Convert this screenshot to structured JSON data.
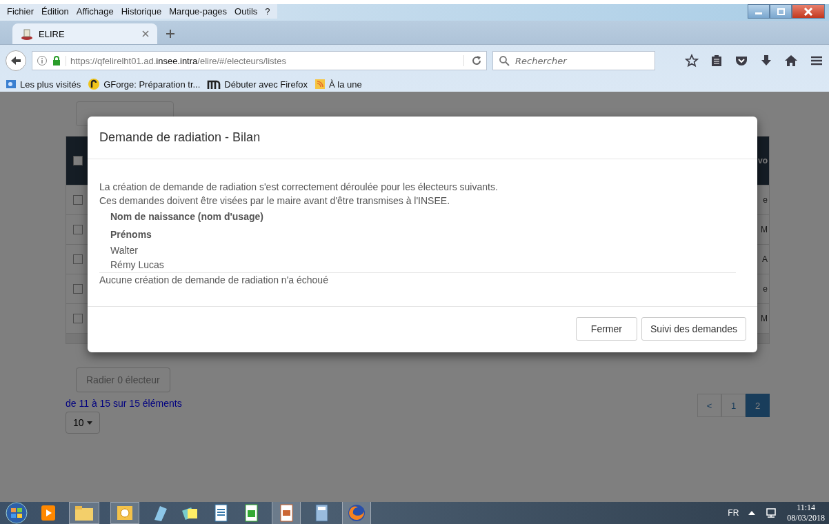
{
  "menu": [
    "Fichier",
    "Édition",
    "Affichage",
    "Historique",
    "Marque-pages",
    "Outils",
    "?"
  ],
  "tabs": [
    {
      "label": "ELIRE",
      "selected": true
    }
  ],
  "url": {
    "prefix": "https://qfelirelht01.ad.",
    "domain": "insee.intra",
    "path": "/elire/#/electeurs/listes"
  },
  "search": {
    "placeholder": "Rechercher"
  },
  "bookmarks": [
    {
      "kind": "visited",
      "label": "Les plus visités"
    },
    {
      "kind": "gforge",
      "label": "GForge: Préparation tr..."
    },
    {
      "kind": "m",
      "label": "Débuter avec Firefox"
    },
    {
      "kind": "rss",
      "label": "À la une"
    }
  ],
  "table": {
    "header": {
      "checked": false,
      "column_2": "vo"
    },
    "rows": [
      {
        "checked": false,
        "column_2": "e"
      },
      {
        "checked": false,
        "column_2": "M"
      },
      {
        "checked": false,
        "column_2": "A"
      },
      {
        "checked": false,
        "column_2": "e"
      },
      {
        "checked": false,
        "column_2": "M"
      }
    ]
  },
  "radiate_button": {
    "label": "Radier 0 électeur",
    "disabled": true
  },
  "range_text": "de 11 à 15 sur 15 éléments",
  "page_size": "10",
  "pagination": [
    {
      "label": "<",
      "selected": false
    },
    {
      "label": "1",
      "selected": false
    },
    {
      "label": "2",
      "selected": true
    }
  ],
  "modal": {
    "title": "Demande de radiation - Bilan",
    "lines": [
      "La création de demande de radiation s'est correctement déroulée pour les électeurs suivants.",
      "Ces demandes doivent être visées par le maire avant d'être transmises à l'INSEE."
    ],
    "headers": [
      "Nom de naissance (nom d'usage)",
      "Prénoms"
    ],
    "names": [
      "Walter",
      "Rémy Lucas"
    ],
    "failure": "Aucune création de demande de radiation n'a échoué",
    "buttons": [
      "Fermer",
      "Suivi des demandes"
    ]
  },
  "taskbar": {
    "language": "FR",
    "time": "11:14",
    "date": "08/03/2018"
  }
}
